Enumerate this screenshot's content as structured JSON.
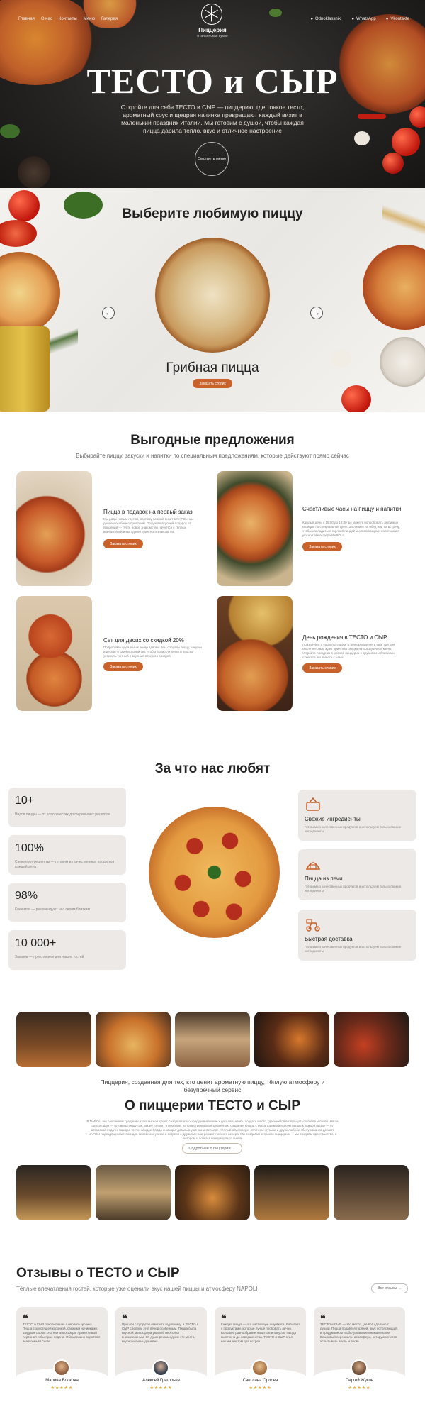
{
  "nav": {
    "items": [
      "Главная",
      "О нас",
      "Контакты",
      "Меню",
      "Галерея"
    ],
    "social": [
      "Odnoklassniki",
      "WhatsApp",
      "Vkontakte"
    ],
    "brand": "Пиццерия",
    "brand_sub": "итальянская кухня"
  },
  "hero": {
    "title": "ТЕСТО и СЫР",
    "text": "Откройте для себя ТЕСТО и СЫР — пиццерию, где тонкое тесто, ароматный соус и щедрая начинка превращают каждый визит в маленький праздник Италии. Мы готовим с душой, чтобы каждая пицца дарила тепло, вкус и отличное настроение",
    "menu_button": "Смотреть меню"
  },
  "choose": {
    "title": "Выберите любимую пиццу",
    "pizza_name": "Грибная пицца",
    "button": "Заказать столик"
  },
  "offers": {
    "title": "Выгодные предложения",
    "subtitle": "Выбирайте пиццу, закуски и напитки по специальным предложениям, которые действуют прямо сейчас",
    "items": [
      {
        "title": "Пицца в подарок на первый заказ",
        "desc": "Мы рады новым гостям, поэтому первый визит в NAPOLI мы делаем особенно приятным. Получите вкусный подарок от пиццерии — пусть новое знакомство начнется с тёплых впечатлений и выгодного приятного знакомства",
        "button": "Заказать столик"
      },
      {
        "title": "Счастливые часы на пиццу и напитки",
        "desc": "Каждый день с 15:00 до 18:00 вы можете попробовать любимые позиции по специальной цене. Загляните на обед или на встречу, чтобы насладиться горячей пиццей и освежающими напитками в уютной атмосфере NAPOLI",
        "button": "Заказать столик"
      },
      {
        "title": "Сет для двоих со скидкой 20%",
        "desc": "Попробуйте идеальный вечер вдвоём. Мы собрали пиццу, закуски и десерт в один вкусный сет, чтобы вы могли легко и просто устроить уютный и вкусный вечер со скидкой",
        "button": "Заказать столик"
      },
      {
        "title": "День рождения в ТЕСТО и СЫР",
        "desc": "Празднуйте с удовольствием. В день рождения и ещё три дня после него вас ждёт приятная скидка на праздничное меню. Устройте праздник в уютной пиццерии с друзьями и близкими, отметьте его вместе с нами",
        "button": "Заказать столик"
      }
    ]
  },
  "why": {
    "title": "За что нас любят",
    "stats": [
      {
        "value": "10+",
        "desc": "Видов пиццы — от классических до фирменных рецептов"
      },
      {
        "value": "100%",
        "desc": "Свежие ингредиенты — готовим из качественных продуктов каждый день"
      },
      {
        "value": "98%",
        "desc": "Клиентов — рекомендуют нас своим близким"
      },
      {
        "value": "10 000+",
        "desc": "Заказов — приготовили для наших гостей"
      }
    ],
    "features": [
      {
        "title": "Свежие ингредиенты",
        "desc": "Готовим из качественных продуктов и используем только свежие ингредиенты"
      },
      {
        "title": "Пицца из печи",
        "desc": "Готовим из качественных продуктов и используем только свежие ингредиенты"
      },
      {
        "title": "Быстрая доставка",
        "desc": "Готовим из качественных продуктов и используем только свежие ингредиенты"
      }
    ]
  },
  "about": {
    "pre": "Пиццерия, созданная для тех, кто ценит ароматную пиццу, тёплую атмосферу и безупречный сервис",
    "title": "О пиццерии ТЕСТО и СЫР",
    "text": "В NAPOLI мы сохраняем традиции итальянской кухни, создавая атмосферу и внимание к деталям, чтобы создать место, где хочется возвращаться снова и снова. Наша философия — готовить пиццу так, как её готовят в Неаполе: на качественных ингредиентах, создания блюда с неповторимым вкусом пиццы к каждой пицце — от авторской подачи. Каждое тесто, каждое блюдо и каждая деталь в уютном интерьере, тёплый атмосфере, отличное музыка и дружелюбное обслуживание делают NAPOLI подходящим местом для семейного ужина и встречи с друзьями или романтического вечера. Мы создаём не просто пиццерию — мы создаём пространство, в котором и хочется возвращаться снова",
    "button": "Подробнее о пиццерии →"
  },
  "reviews": {
    "title": "Отзывы о ТЕСТО и СЫР",
    "subtitle": "Тёплые впечатления гостей, которые уже оценили вкус нашей пиццы и атмосферу NAPOLI",
    "all_button": "Все отзывы →",
    "items": [
      {
        "text": "ТЕСТО и СЫР покорили нас с первого кусочка. Пицца с хрустящей корочкой, свежими начинками, щедрым сыром. Уютная атмосфера, приветливый персонал и быстрая подача. Обязательно вернёмся всей семьёй снова",
        "name": "Марина Волкова",
        "stars": "★★★★★"
      },
      {
        "text": "Пришли с супругой отметить годовщину, и ТЕСТО и СЫР сделали этот вечер особенным. Пицца была вкусной, атмосфера уютной, персонал внимательным. От души рекомендуем это место, вкусно и очень душевно",
        "name": "Алексей Григорьев",
        "stars": "★★★★★"
      },
      {
        "text": "Каждая пицца — это настоящее шоу вкуса. Работает с продуктами, которые лучше пробовать лично. Большое разнообразие напитков и закусок. Пицца выпечена до совершенства. ТЕСТО и СЫР стал нашим местом для встреч",
        "name": "Светлана Орлова",
        "stars": "★★★★★"
      },
      {
        "text": "ТЕСТО и СЫР — это место, где всё сделано с душой. Пицца подаётся горячей, вкус потрясающий, в продуманном и обслуживание внимательное. Вежливый персонал и атмосфера, которую хочется испытывать вновь и вновь",
        "name": "Сергей Жуков",
        "stars": "★★★★★"
      }
    ]
  },
  "colors": {
    "accent": "#c8612a",
    "card_bg": "#ece9e6",
    "hero_bg": "#252322",
    "star": "#e0a320"
  }
}
